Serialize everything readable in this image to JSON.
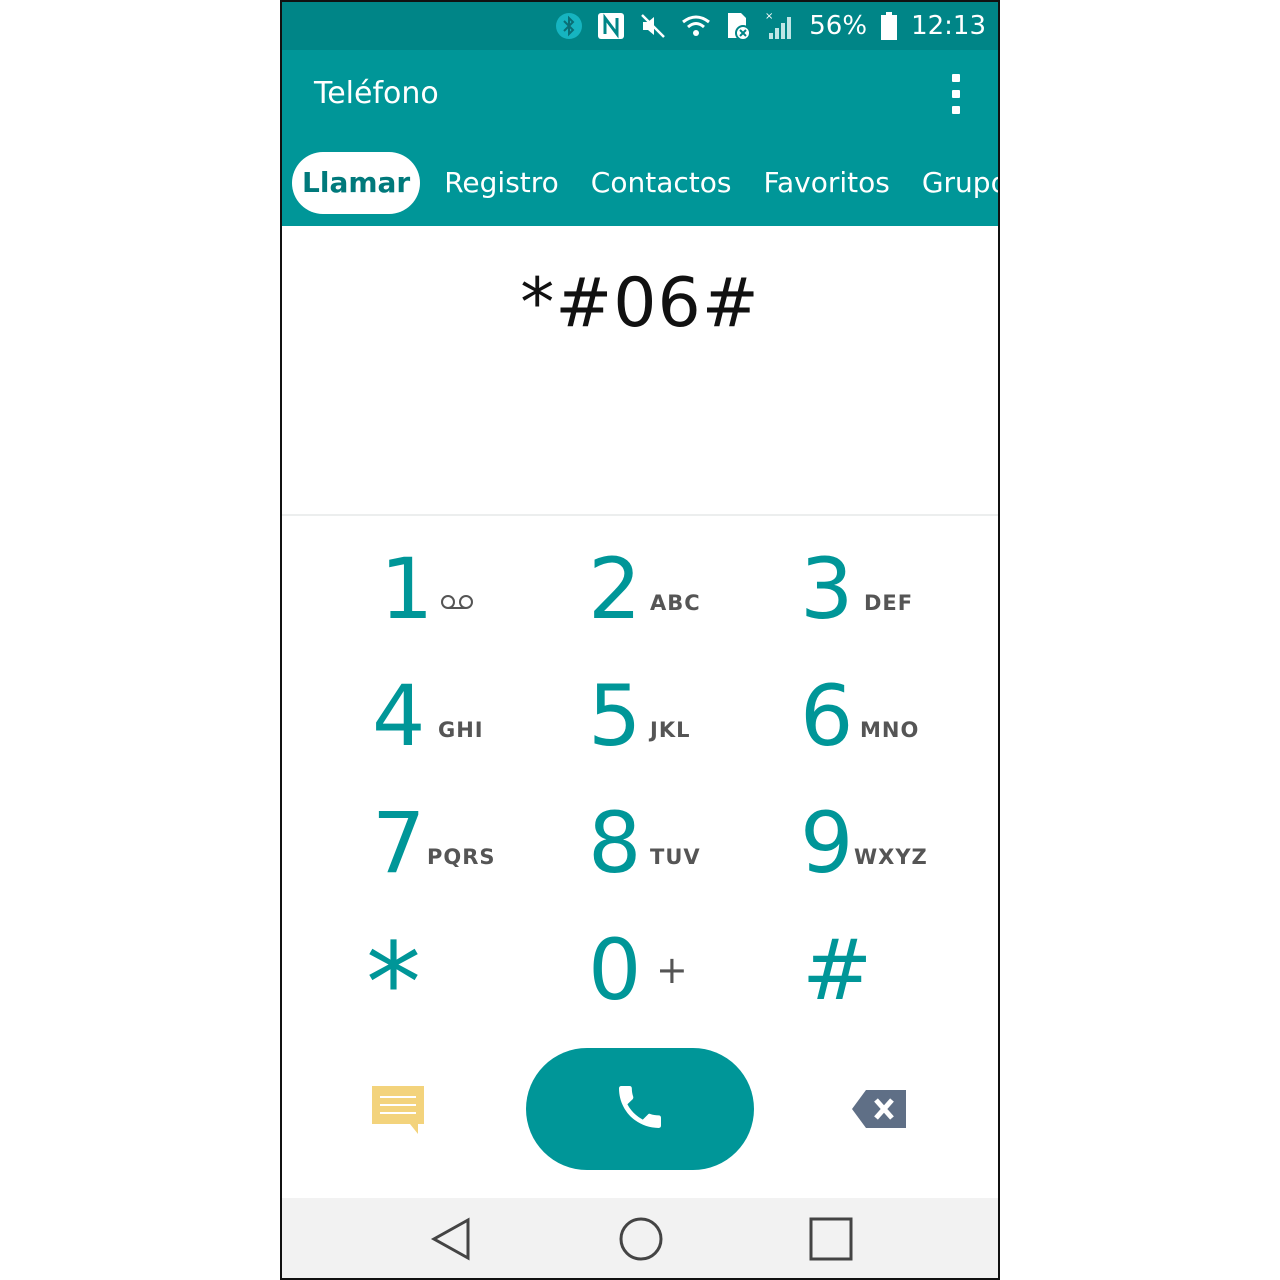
{
  "status_bar": {
    "icons": [
      "bluetooth-icon",
      "nfc-icon",
      "mute-icon",
      "wifi-icon",
      "sd-card-icon",
      "signal-icon",
      "battery-icon"
    ],
    "battery": "56%",
    "time": "12:13"
  },
  "app_bar": {
    "title": "Teléfono",
    "menu_icon": "more-vert-icon"
  },
  "tabs": [
    {
      "label": "Llamar",
      "active": true
    },
    {
      "label": "Registro",
      "active": false
    },
    {
      "label": "Contactos",
      "active": false
    },
    {
      "label": "Favoritos",
      "active": false
    },
    {
      "label": "Grupos",
      "active": false
    }
  ],
  "dialed_number": "*#06#",
  "keypad": [
    {
      "digit": "1",
      "letters": "",
      "sub_icon": "voicemail-icon"
    },
    {
      "digit": "2",
      "letters": "ABC"
    },
    {
      "digit": "3",
      "letters": "DEF"
    },
    {
      "digit": "4",
      "letters": "GHI"
    },
    {
      "digit": "5",
      "letters": "JKL"
    },
    {
      "digit": "6",
      "letters": "MNO"
    },
    {
      "digit": "7",
      "letters": "PQRS"
    },
    {
      "digit": "8",
      "letters": "TUV"
    },
    {
      "digit": "9",
      "letters": "WXYZ"
    },
    {
      "digit": "*",
      "letters": ""
    },
    {
      "digit": "0",
      "letters": "+"
    },
    {
      "digit": "#",
      "letters": ""
    }
  ],
  "actions": {
    "message_icon": "message-icon",
    "call_icon": "phone-icon",
    "delete_icon": "backspace-icon"
  },
  "navigation": [
    "back-icon",
    "home-icon",
    "recents-icon"
  ],
  "colors": {
    "status_bar": "#008587",
    "app_bar": "#009698",
    "accent": "#009698",
    "message_icon": "#f3d37c",
    "delete_icon": "#5f6f86"
  }
}
